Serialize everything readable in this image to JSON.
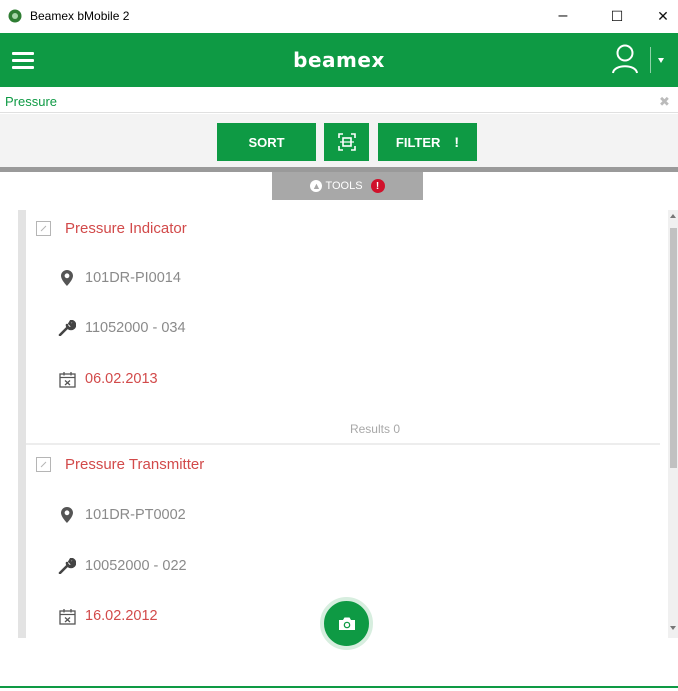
{
  "window": {
    "title": "Beamex bMobile 2",
    "minimize": "–",
    "maximize": "☐",
    "close": "✕"
  },
  "appbar": {
    "brand": "beamex"
  },
  "search": {
    "value": "Pressure",
    "clear": "✖"
  },
  "toolbar": {
    "sort_label": "SORT",
    "filter_label": "FILTER",
    "filter_badge": "!"
  },
  "tools": {
    "label": "TOOLS",
    "alert": "!"
  },
  "devices": [
    {
      "name": "Pressure Indicator",
      "position": "101DR-PI0014",
      "serial": "11052000 - 034",
      "date": "06.02.2013",
      "results": "Results 0"
    },
    {
      "name": "Pressure Transmitter",
      "position": "101DR-PT0002",
      "serial": "10052000 - 022",
      "date": "16.02.2012"
    }
  ],
  "colors": {
    "brand_green": "#0e9a44",
    "accent_red": "#d24a4a",
    "alert_red": "#d0112b"
  },
  "icons": {
    "menu": "hamburger-icon",
    "user": "user-icon",
    "location": "map-pin-icon",
    "serial": "wrench-icon",
    "date": "calendar-icon",
    "camera": "camera-icon",
    "scan": "scan-icon"
  }
}
